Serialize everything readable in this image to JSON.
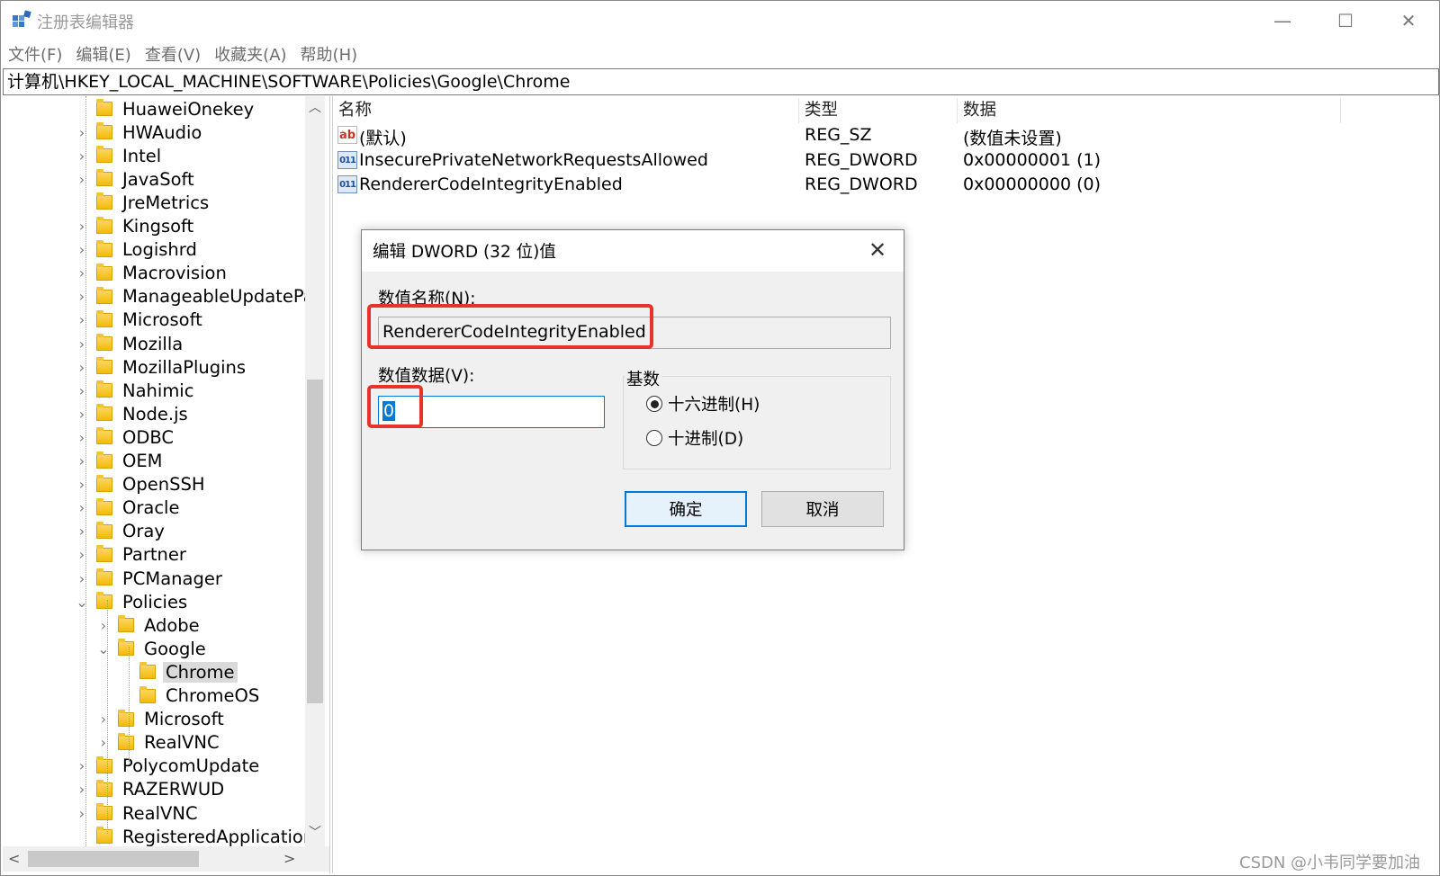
{
  "window": {
    "title": "注册表编辑器",
    "controls": {
      "minimize": "—",
      "maximize": "☐",
      "close": "✕"
    }
  },
  "menu": [
    "文件(F)",
    "编辑(E)",
    "查看(V)",
    "收藏夹(A)",
    "帮助(H)"
  ],
  "address": "计算机\\HKEY_LOCAL_MACHINE\\SOFTWARE\\Policies\\Google\\Chrome",
  "tree": [
    {
      "label": "HuaweiOnekey",
      "level": 0,
      "expander": "none"
    },
    {
      "label": "HWAudio",
      "level": 0,
      "expander": "collapsed"
    },
    {
      "label": "Intel",
      "level": 0,
      "expander": "collapsed"
    },
    {
      "label": "JavaSoft",
      "level": 0,
      "expander": "collapsed"
    },
    {
      "label": "JreMetrics",
      "level": 0,
      "expander": "none"
    },
    {
      "label": "Kingsoft",
      "level": 0,
      "expander": "collapsed"
    },
    {
      "label": "Logishrd",
      "level": 0,
      "expander": "collapsed"
    },
    {
      "label": "Macrovision",
      "level": 0,
      "expander": "collapsed"
    },
    {
      "label": "ManageableUpdatePack",
      "level": 0,
      "expander": "collapsed"
    },
    {
      "label": "Microsoft",
      "level": 0,
      "expander": "collapsed"
    },
    {
      "label": "Mozilla",
      "level": 0,
      "expander": "collapsed"
    },
    {
      "label": "MozillaPlugins",
      "level": 0,
      "expander": "collapsed"
    },
    {
      "label": "Nahimic",
      "level": 0,
      "expander": "collapsed"
    },
    {
      "label": "Node.js",
      "level": 0,
      "expander": "collapsed"
    },
    {
      "label": "ODBC",
      "level": 0,
      "expander": "collapsed"
    },
    {
      "label": "OEM",
      "level": 0,
      "expander": "collapsed"
    },
    {
      "label": "OpenSSH",
      "level": 0,
      "expander": "collapsed"
    },
    {
      "label": "Oracle",
      "level": 0,
      "expander": "collapsed"
    },
    {
      "label": "Oray",
      "level": 0,
      "expander": "collapsed"
    },
    {
      "label": "Partner",
      "level": 0,
      "expander": "collapsed"
    },
    {
      "label": "PCManager",
      "level": 0,
      "expander": "collapsed"
    },
    {
      "label": "Policies",
      "level": 0,
      "expander": "expanded"
    },
    {
      "label": "Adobe",
      "level": 1,
      "expander": "collapsed"
    },
    {
      "label": "Google",
      "level": 1,
      "expander": "expanded"
    },
    {
      "label": "Chrome",
      "level": 2,
      "expander": "none",
      "selected": true
    },
    {
      "label": "ChromeOS",
      "level": 2,
      "expander": "none"
    },
    {
      "label": "Microsoft",
      "level": 1,
      "expander": "collapsed"
    },
    {
      "label": "RealVNC",
      "level": 1,
      "expander": "collapsed"
    },
    {
      "label": "PolycomUpdate",
      "level": 0,
      "expander": "collapsed"
    },
    {
      "label": "RAZERWUD",
      "level": 0,
      "expander": "collapsed"
    },
    {
      "label": "RealVNC",
      "level": 0,
      "expander": "collapsed"
    },
    {
      "label": "RegisteredApplications",
      "level": 0,
      "expander": "none"
    }
  ],
  "columns": {
    "name": "名称",
    "type": "类型",
    "data": "数据"
  },
  "values": [
    {
      "icon": "string-value-icon",
      "icon_text": "ab",
      "name": "(默认)",
      "type": "REG_SZ",
      "data": "(数值未设置)"
    },
    {
      "icon": "binary-value-icon",
      "icon_text": "011",
      "name": "InsecurePrivateNetworkRequestsAllowed",
      "type": "REG_DWORD",
      "data": "0x00000001 (1)"
    },
    {
      "icon": "binary-value-icon",
      "icon_text": "011",
      "name": "RendererCodeIntegrityEnabled",
      "type": "REG_DWORD",
      "data": "0x00000000 (0)"
    }
  ],
  "dialog": {
    "title": "编辑 DWORD (32 位)值",
    "name_label": "数值名称(N):",
    "name_value": "RendererCodeIntegrityEnabled",
    "data_label": "数值数据(V):",
    "data_value": "0",
    "base_label": "基数",
    "radios": [
      {
        "label": "十六进制(H)",
        "checked": true
      },
      {
        "label": "十进制(D)",
        "checked": false
      }
    ],
    "ok": "确定",
    "cancel": "取消"
  },
  "watermark": "CSDN @小韦同学要加油",
  "colors": {
    "accent": "#0078d7",
    "highlight": "#e8332b",
    "folder": "#f0b900"
  }
}
